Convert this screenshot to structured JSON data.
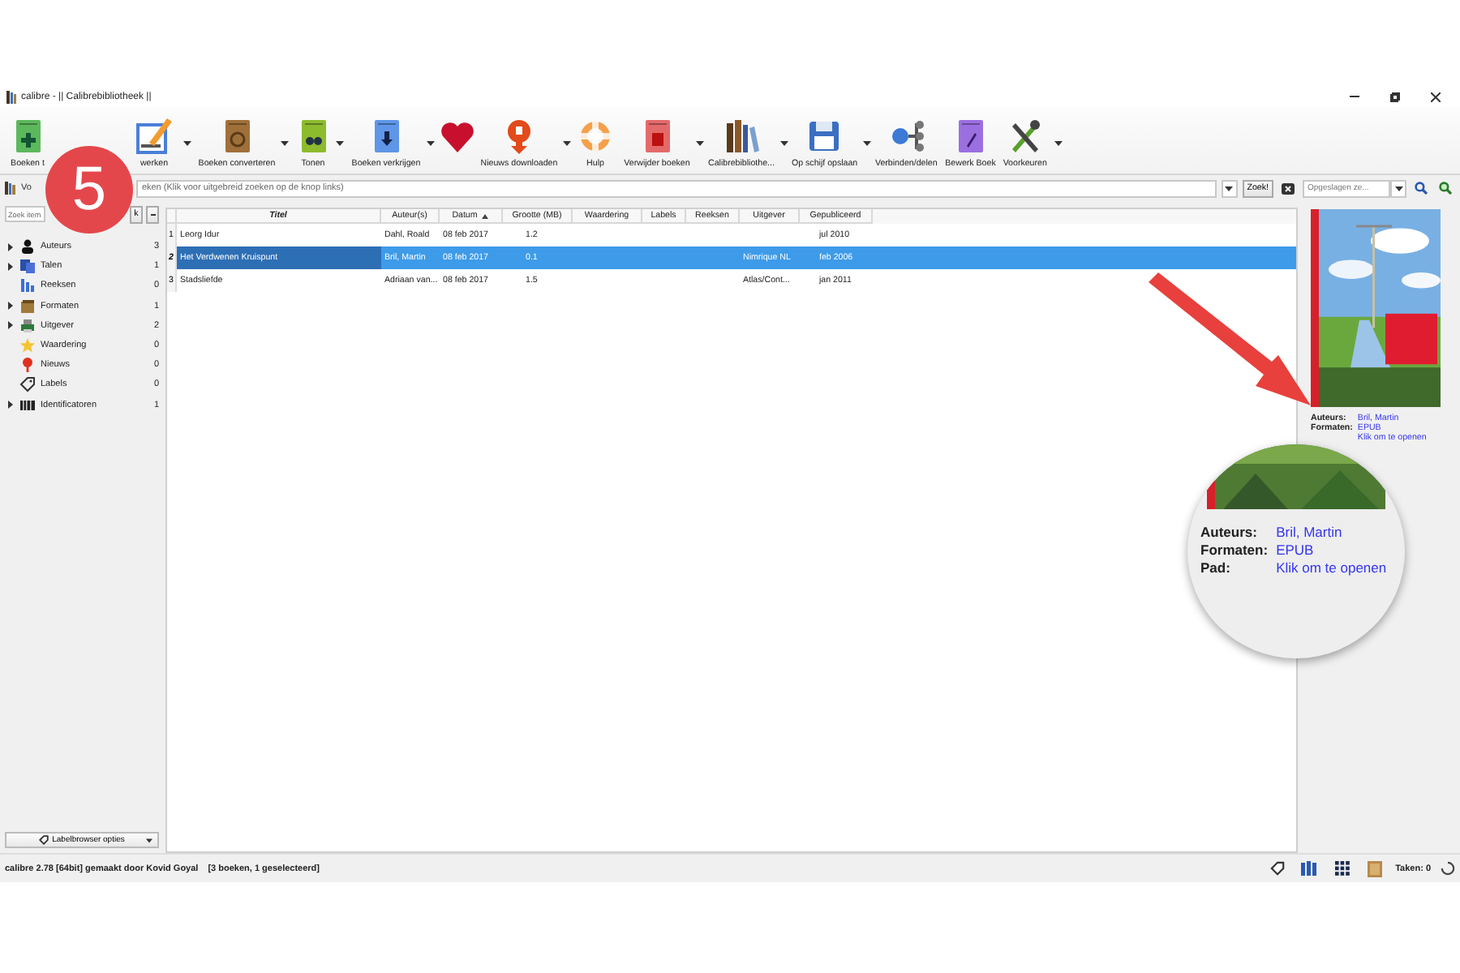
{
  "window": {
    "title": "calibre - || Calibrebibliotheek ||"
  },
  "toolbar": [
    {
      "label": "Boeken t",
      "dropdown": false
    },
    {
      "label": "werken",
      "dropdown": true
    },
    {
      "label": "Boeken converteren",
      "dropdown": true
    },
    {
      "label": "Tonen",
      "dropdown": true
    },
    {
      "label": "Boeken verkrijgen",
      "dropdown": true
    },
    {
      "dropdown": false
    },
    {
      "label": "Nieuws downloaden",
      "dropdown": true
    },
    {
      "label": "Hulp",
      "dropdown": false
    },
    {
      "label": "Verwijder boeken",
      "dropdown": true
    },
    {
      "label": "Calibrebibliothe...",
      "dropdown": true
    },
    {
      "label": "Op schijf opslaan",
      "dropdown": true
    },
    {
      "label": "Verbinden/delen",
      "dropdown": false
    },
    {
      "label": "Bewerk Boek",
      "dropdown": false
    },
    {
      "label": "Voorkeuren",
      "dropdown": true
    }
  ],
  "search": {
    "mode_label": "Vo",
    "placeholder": "eken (Klik voor uitgebreid zoeken op de knop links)",
    "button": "Zoek!",
    "saved_search": {
      "placeholder": "Opgeslagen ze..."
    }
  },
  "tag_browser": {
    "search_placeholder": "Zoek item",
    "find_button": "k",
    "items": [
      {
        "label": "Auteurs",
        "count": "3",
        "expandable": true
      },
      {
        "label": "Talen",
        "count": "1",
        "expandable": true
      },
      {
        "label": "Reeksen",
        "count": "0",
        "expandable": false
      },
      {
        "label": "Formaten",
        "count": "1",
        "expandable": true
      },
      {
        "label": "Uitgever",
        "count": "2",
        "expandable": true
      },
      {
        "label": "Waardering",
        "count": "0",
        "expandable": false
      },
      {
        "label": "Nieuws",
        "count": "0",
        "expandable": false
      },
      {
        "label": "Labels",
        "count": "0",
        "expandable": false
      },
      {
        "label": "Identificatoren",
        "count": "1",
        "expandable": true
      }
    ],
    "options_button": "Labelbrowser opties"
  },
  "table": {
    "columns": [
      {
        "label": "Titel",
        "sorted": false
      },
      {
        "label": "Auteur(s)",
        "sorted": false
      },
      {
        "label": "Datum",
        "sorted": true
      },
      {
        "label": "Grootte (MB)",
        "sorted": false
      },
      {
        "label": "Waardering",
        "sorted": false
      },
      {
        "label": "Labels",
        "sorted": false
      },
      {
        "label": "Reeksen",
        "sorted": false
      },
      {
        "label": "Uitgever",
        "sorted": false
      },
      {
        "label": "Gepubliceerd",
        "sorted": false
      }
    ],
    "rows": [
      {
        "number": "1",
        "selected": false,
        "title": "Leorg Idur",
        "authors": "Dahl, Roald",
        "date": "08 feb 2017",
        "size": "1.2",
        "published": "jul 2010"
      },
      {
        "number": "2",
        "selected": true,
        "title": "Het Verdwenen Kruispunt",
        "authors": "Bril, Martin",
        "date": "08 feb 2017",
        "size": "0.1",
        "publisher": "Nimrique NL",
        "published": "feb 2006"
      },
      {
        "number": "3",
        "selected": false,
        "title": "Stadsliefde",
        "authors": "Adriaan van...",
        "date": "08 feb 2017",
        "size": "1.5",
        "publisher": "Atlas/Cont...",
        "published": "jan 2011"
      }
    ]
  },
  "details": [
    {
      "label": "Auteurs:",
      "value": "Bril, Martin"
    },
    {
      "label": "Formaten:",
      "value": "EPUB"
    },
    {
      "value": "Klik om te openen"
    }
  ],
  "status_bar": {
    "text": "calibre 2.78 [64bit] gemaakt door Kovid Goyal",
    "selection": "[3 boeken, 1 geselecteerd]",
    "jobs": "Taken: 0"
  },
  "annotation": {
    "number": "5",
    "callout_details": [
      {
        "label": "Auteurs:",
        "value": "Bril, Martin"
      },
      {
        "label": "Formaten:",
        "value": "EPUB"
      },
      {
        "label": "Pad:",
        "value": "Klik om te openen"
      }
    ]
  }
}
